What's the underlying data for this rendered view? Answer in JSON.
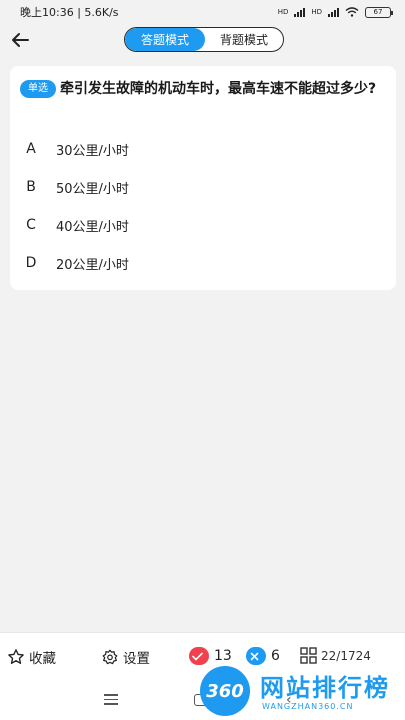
{
  "status_bar": {
    "time_speed": "晚上10:36 | 5.6K/s",
    "network1": "HD",
    "network2": "HD",
    "battery": "67"
  },
  "header": {
    "back_icon": "arrow-left-icon",
    "mode_answer": "答题模式",
    "mode_recite": "背题模式"
  },
  "question": {
    "type_badge": "单选",
    "text": "牵引发生故障的机动车时，最高车速不能超过多少?",
    "options": [
      {
        "letter": "A",
        "text": "30公里/小时"
      },
      {
        "letter": "B",
        "text": "50公里/小时"
      },
      {
        "letter": "C",
        "text": "40公里/小时"
      },
      {
        "letter": "D",
        "text": "20公里/小时"
      }
    ]
  },
  "bottom_bar": {
    "favorite_label": "收藏",
    "settings_label": "设置",
    "wrong_count": "13",
    "right_count": "6",
    "progress_current": "22",
    "progress_total": "/1724"
  },
  "watermark": {
    "logo_text": "360",
    "title": "网站排行榜",
    "url": "WANGZHAN360.CN"
  },
  "colors": {
    "accent": "#1e9bf0",
    "wrong": "#f0414c"
  }
}
